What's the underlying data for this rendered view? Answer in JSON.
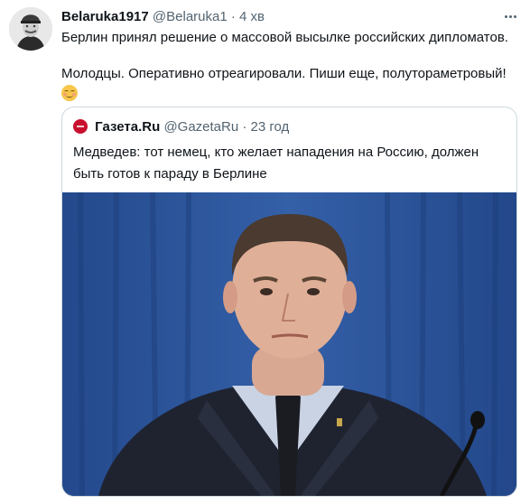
{
  "tweet": {
    "author_name": "Belaruka1917",
    "author_handle": "@Belaruka1",
    "separator": "·",
    "time": "4 хв",
    "text_line1": "Берлин принял решение о массовой высылке российских дипломатов.",
    "text_line2": "Молодцы. Оперативно отреагировали. Пиши еще, полутораметровый!",
    "emoji": "relieved-face-icon"
  },
  "quote": {
    "author_name": "Газета.Ru",
    "author_handle": "@GazetaRu",
    "separator": "·",
    "time": "23 год",
    "text": "Медведев: тот немец, кто желает нападения на Россию, должен быть готов к параду в Берлине"
  },
  "colors": {
    "text": "#0f1419",
    "meta": "#536471",
    "border": "#cfd9de",
    "gazeta_brand": "#c8102e",
    "photo_bg": "#2d4f8f"
  }
}
